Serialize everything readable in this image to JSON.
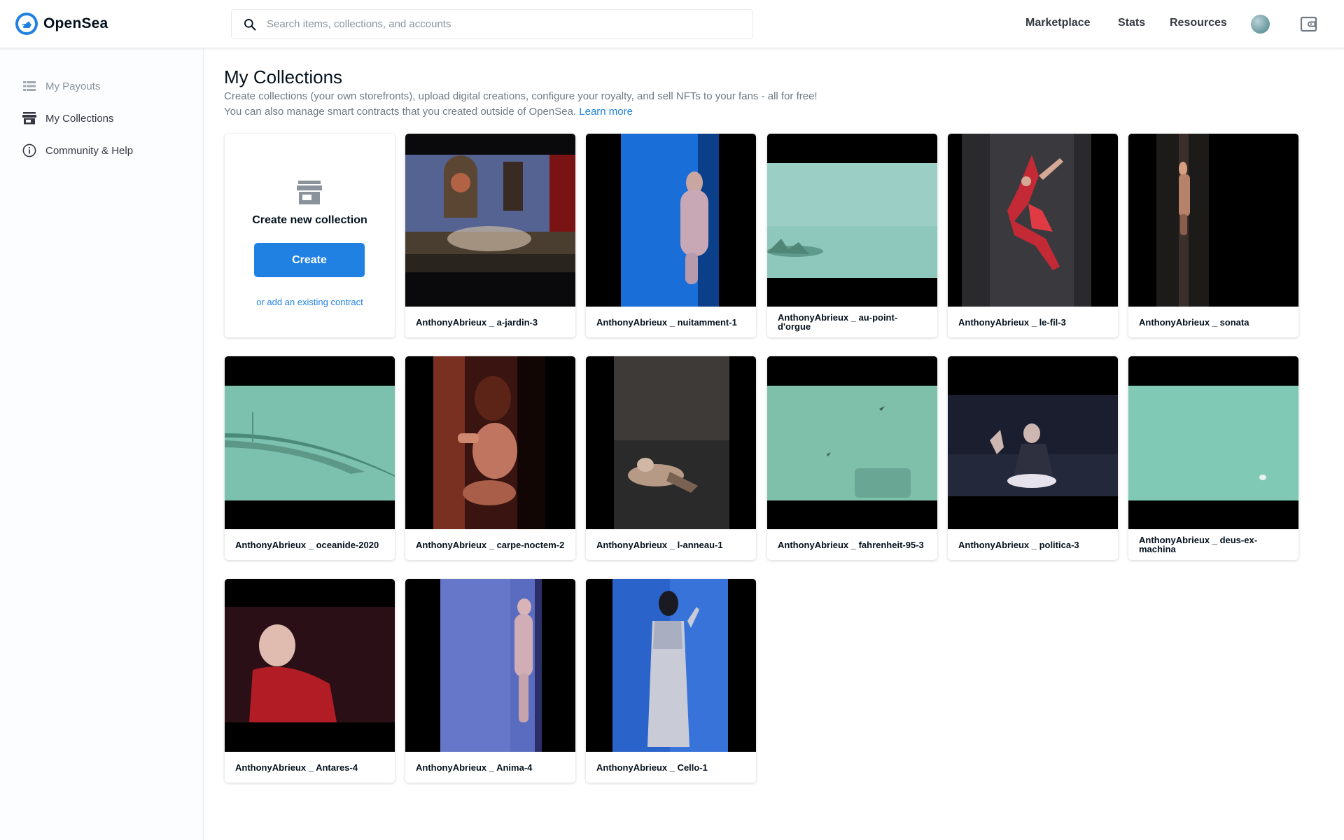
{
  "header": {
    "logo_text": "OpenSea",
    "search_placeholder": "Search items, collections, and accounts",
    "nav": [
      "Marketplace",
      "Stats",
      "Resources"
    ]
  },
  "sidebar": {
    "items": [
      {
        "label": "My Payouts",
        "icon": "list-icon",
        "active": false
      },
      {
        "label": "My Collections",
        "icon": "storefront-icon",
        "active": true
      },
      {
        "label": "Community & Help",
        "icon": "info-icon",
        "active": false
      }
    ]
  },
  "main": {
    "title": "My Collections",
    "desc_line1": "Create collections (your own storefronts), upload digital creations, configure your royalty, and sell NFTs to your fans - all for free!",
    "desc_line2": "You can also manage smart contracts that you created outside of OpenSea.",
    "learn_more": "Learn more",
    "create_card": {
      "title": "Create new collection",
      "button": "Create",
      "link": "or add an existing contract"
    },
    "collections": [
      {
        "name": "AnthonyAbrieux _ a-jardin-3"
      },
      {
        "name": "AnthonyAbrieux _ nuitamment-1"
      },
      {
        "name": "AnthonyAbrieux _ au-point-d'orgue"
      },
      {
        "name": "AnthonyAbrieux _ le-fil-3"
      },
      {
        "name": "AnthonyAbrieux _ sonata"
      },
      {
        "name": "AnthonyAbrieux _ oceanide-2020"
      },
      {
        "name": "AnthonyAbrieux _ carpe-noctem-2"
      },
      {
        "name": "AnthonyAbrieux _ l-anneau-1"
      },
      {
        "name": "AnthonyAbrieux _ fahrenheit-95-3"
      },
      {
        "name": "AnthonyAbrieux _ politica-3"
      },
      {
        "name": "AnthonyAbrieux _ deus-ex-machina"
      },
      {
        "name": "AnthonyAbrieux _ Antares-4"
      },
      {
        "name": "AnthonyAbrieux _ Anima-4"
      },
      {
        "name": "AnthonyAbrieux _ Cello-1"
      }
    ]
  },
  "colors": {
    "accent": "#2081e2",
    "text": "#353840",
    "muted": "#707a83"
  }
}
